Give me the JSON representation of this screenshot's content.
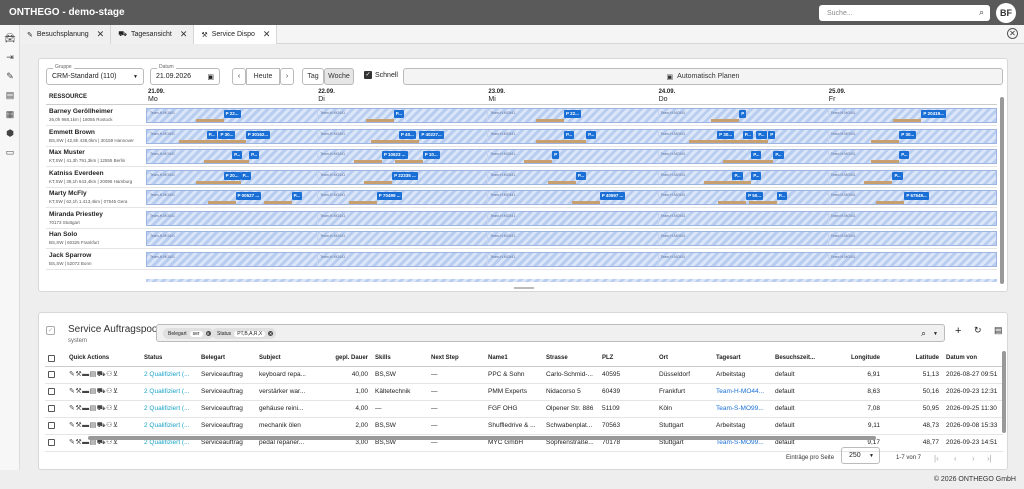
{
  "app": {
    "title": "ONTHEGO - demo-stage",
    "search_placeholder": "Suche...",
    "user_initials": "BF"
  },
  "tabs": [
    {
      "label": "Besuchsplanung",
      "icon": "wand-icon"
    },
    {
      "label": "Tagesansicht",
      "icon": "car-icon"
    },
    {
      "label": "Service Dispo",
      "icon": "tools-icon"
    }
  ],
  "toolbar": {
    "group_label": "Gruppe",
    "group_value": "CRM-Standard (110)",
    "date_label": "Datum",
    "date_value": "21.09.2026",
    "today_label": "Heute",
    "view_day": "Tag",
    "view_week": "Woche",
    "quick_label": "Schnell",
    "auto_plan_label": "Automatisch Planen"
  },
  "gantt": {
    "resource_header": "RESSOURCE",
    "days": [
      {
        "date": "21.09.",
        "weekday": "Mo"
      },
      {
        "date": "22.09.",
        "weekday": "Di"
      },
      {
        "date": "23.09.",
        "weekday": "Mi"
      },
      {
        "date": "24.09.",
        "weekday": "Do"
      },
      {
        "date": "25.09.",
        "weekday": "Fr"
      }
    ],
    "lane_label": "Team-H-MO441",
    "resources": [
      {
        "name": "Barney Geröllheimer",
        "sub": "26,0h 968,1km | 18055 Rostock",
        "chips": [
          {
            "d": 0,
            "p": 0.45,
            "t": "P 22..."
          },
          {
            "d": 1,
            "p": 0.45,
            "t": "P..."
          },
          {
            "d": 2,
            "p": 0.45,
            "t": "P 22..."
          },
          {
            "d": 3,
            "p": 0.48,
            "t": "P"
          },
          {
            "d": 4,
            "p": 0.55,
            "t": "P 20419..."
          }
        ]
      },
      {
        "name": "Emmett Brown",
        "sub": "BS,SW | 42,5h 438,0km | 30159 Hannover",
        "chips": [
          {
            "d": 0,
            "p": 0.35,
            "t": "P..."
          },
          {
            "d": 0,
            "p": 0.42,
            "t": "P 30..."
          },
          {
            "d": 0,
            "p": 0.58,
            "t": "P 30162..."
          },
          {
            "d": 1,
            "p": 0.48,
            "t": "P 40..."
          },
          {
            "d": 1,
            "p": 0.6,
            "t": "P 40227..."
          },
          {
            "d": 2,
            "p": 0.45,
            "t": "P..."
          },
          {
            "d": 2,
            "p": 0.58,
            "t": "P..."
          },
          {
            "d": 3,
            "p": 0.35,
            "t": "P 30..."
          },
          {
            "d": 3,
            "p": 0.5,
            "t": "P..."
          },
          {
            "d": 3,
            "p": 0.58,
            "t": "P..."
          },
          {
            "d": 3,
            "p": 0.65,
            "t": "P"
          },
          {
            "d": 4,
            "p": 0.42,
            "t": "P 30..."
          }
        ]
      },
      {
        "name": "Max Muster",
        "sub": "KT,SW | 41,3h 791,3km | 12555 Berlin",
        "chips": [
          {
            "d": 0,
            "p": 0.5,
            "t": "P..."
          },
          {
            "d": 0,
            "p": 0.6,
            "t": "P..."
          },
          {
            "d": 1,
            "p": 0.38,
            "t": "P 10623 ..."
          },
          {
            "d": 1,
            "p": 0.62,
            "t": "P 10..."
          },
          {
            "d": 2,
            "p": 0.38,
            "t": "P"
          },
          {
            "d": 3,
            "p": 0.55,
            "t": "P..."
          },
          {
            "d": 3,
            "p": 0.68,
            "t": "P..."
          },
          {
            "d": 4,
            "p": 0.42,
            "t": "P..."
          }
        ]
      },
      {
        "name": "Katniss Everdeen",
        "sub": "KT,SW | 38,1h 643,4km | 20095 Hamburg",
        "chips": [
          {
            "d": 0,
            "p": 0.45,
            "t": "P 20..."
          },
          {
            "d": 0,
            "p": 0.55,
            "t": "P..."
          },
          {
            "d": 1,
            "p": 0.44,
            "t": "P 22335 ..."
          },
          {
            "d": 2,
            "p": 0.52,
            "t": "P..."
          },
          {
            "d": 3,
            "p": 0.44,
            "t": "P..."
          },
          {
            "d": 3,
            "p": 0.55,
            "t": "P..."
          },
          {
            "d": 4,
            "p": 0.38,
            "t": "P..."
          }
        ]
      },
      {
        "name": "Marty McFly",
        "sub": "KT,SW | 62,1h 1.413,4km | 07545 Gera",
        "chips": [
          {
            "d": 0,
            "p": 0.52,
            "t": "P 00527 ..."
          },
          {
            "d": 0,
            "p": 0.85,
            "t": "P..."
          },
          {
            "d": 1,
            "p": 0.35,
            "t": "P 70499 ..."
          },
          {
            "d": 2,
            "p": 0.66,
            "t": "P 40597 ..."
          },
          {
            "d": 3,
            "p": 0.52,
            "t": "P 50..."
          },
          {
            "d": 3,
            "p": 0.7,
            "t": "P..."
          },
          {
            "d": 4,
            "p": 0.45,
            "t": "P 67549..."
          }
        ]
      },
      {
        "name": "Miranda Priestley",
        "sub": "70173 Stuttgart",
        "chips": []
      },
      {
        "name": "Han Solo",
        "sub": "BS,SW | 60325 Frankfurt",
        "chips": []
      },
      {
        "name": "Jack Sparrow",
        "sub": "BS,SW | 52072 Bonn",
        "chips": []
      }
    ]
  },
  "pool": {
    "title": "Service Auftragspool",
    "subtitle": "system",
    "filters": [
      {
        "key": "Belegart",
        "value": "ser"
      },
      {
        "key": "Status",
        "value": "PT,B,A,R,X"
      }
    ],
    "columns": [
      "Quick Actions",
      "Status",
      "Belegart",
      "Subject",
      "gepl. Dauer",
      "Skills",
      "Next Step",
      "Name1",
      "Strasse",
      "PLZ",
      "Ort",
      "Tagesart",
      "Besuchszeit...",
      "Longitude",
      "Latitude",
      "Datum von"
    ],
    "rows": [
      {
        "status": "2 Qualifiziert (...",
        "belegart": "Serviceauftrag",
        "subject": "keyboard repa...",
        "dauer": "40,00",
        "skills": "BS,SW",
        "next": "—",
        "name1": "PPC & Sohn",
        "strasse": "Carlo-Schmid-...",
        "plz": "40595",
        "ort": "Düsseldorf",
        "tagesart": "Arbeitstag",
        "besuch": "default",
        "lon": "6,91",
        "lat": "51,13",
        "datum": "2026-08-27 09:51"
      },
      {
        "status": "2 Qualifiziert (...",
        "belegart": "Serviceauftrag",
        "subject": "verstärker war...",
        "dauer": "1,00",
        "skills": "Kältetechnik",
        "next": "—",
        "name1": "PMM Experts",
        "strasse": "Nidacorso 5",
        "plz": "60439",
        "ort": "Frankfurt",
        "tagesart": "Team-H-MO44...",
        "besuch": "default",
        "lon": "8,63",
        "lat": "50,16",
        "datum": "2026-09-23 12:31"
      },
      {
        "status": "2 Qualifiziert (...",
        "belegart": "Serviceauftrag",
        "subject": "gehäuse reini...",
        "dauer": "4,00",
        "skills": "—",
        "next": "—",
        "name1": "FGF OHG",
        "strasse": "Olpener Str. 886",
        "plz": "51109",
        "ort": "Köln",
        "tagesart": "Team-S-MO99...",
        "besuch": "default",
        "lon": "7,08",
        "lat": "50,95",
        "datum": "2026-09-25 11:30"
      },
      {
        "status": "2 Qualifiziert (...",
        "belegart": "Serviceauftrag",
        "subject": "mechanik ölen",
        "dauer": "2,00",
        "skills": "BS,SW",
        "next": "—",
        "name1": "Shuffledrive & ...",
        "strasse": "Schwabenplat...",
        "plz": "70563",
        "ort": "Stuttgart",
        "tagesart": "Arbeitstag",
        "besuch": "default",
        "lon": "9,11",
        "lat": "48,73",
        "datum": "2026-09-08 15:33"
      },
      {
        "status": "2 Qualifiziert (...",
        "belegart": "Serviceauftrag",
        "subject": "pedal reparier...",
        "dauer": "3,00",
        "skills": "BS,SW",
        "next": "—",
        "name1": "MYC GmbH",
        "strasse": "Sophienstraße...",
        "plz": "70178",
        "ort": "Stuttgart",
        "tagesart": "Team-S-MO99...",
        "besuch": "default",
        "lon": "9,17",
        "lat": "48,77",
        "datum": "2026-09-23 14:51"
      }
    ],
    "pager": {
      "per_page_label": "Einträge pro Seite",
      "per_page": "250",
      "range": "1-7 von 7"
    }
  },
  "footer": "© 2026 ONTHEGO GmbH"
}
